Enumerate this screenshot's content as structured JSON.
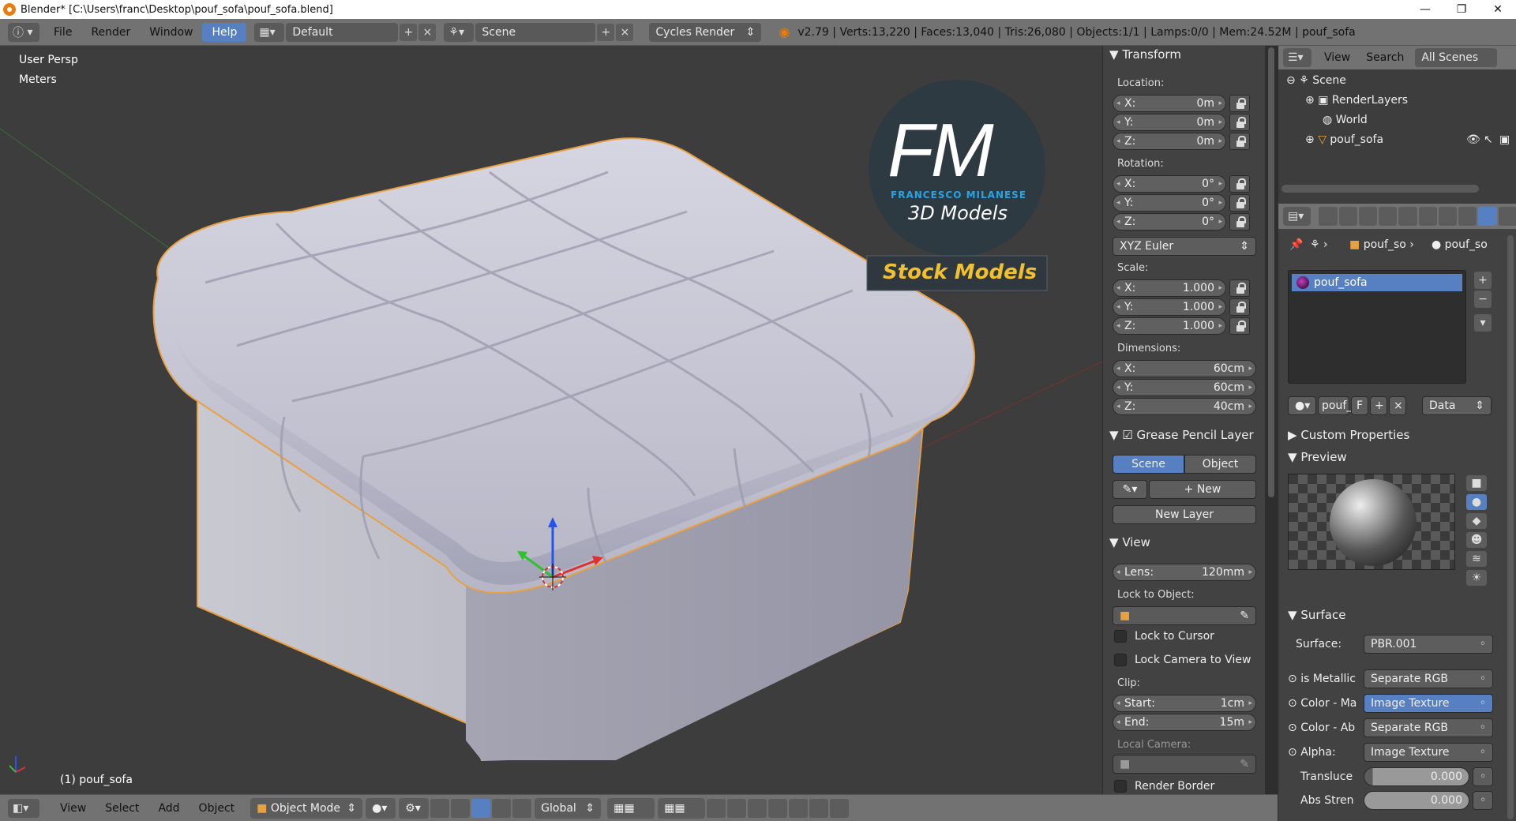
{
  "window": {
    "title": "Blender* [C:\\Users\\franc\\Desktop\\pouf_sofa\\pouf_sofa.blend]"
  },
  "topbar": {
    "menus": [
      "File",
      "Render",
      "Window",
      "Help"
    ],
    "screen": "Default",
    "scene": "Scene",
    "engine": "Cycles Render",
    "stats": "v2.79 | Verts:13,220 | Faces:13,040 | Tris:26,080 | Objects:1/1 | Lamps:0/0 | Mem:24.52M | pouf_sofa"
  },
  "viewport": {
    "view_name": "User Persp",
    "units": "Meters",
    "object_label": "(1) pouf_sofa",
    "logo": {
      "letters": "FM",
      "name": "FRANCESCO MILANESE",
      "sub": "3D Models",
      "badge": "Stock Models"
    }
  },
  "npanel": {
    "transform": {
      "header": "Transform",
      "location_label": "Location:",
      "location": [
        {
          "k": "X:",
          "v": "0m"
        },
        {
          "k": "Y:",
          "v": "0m"
        },
        {
          "k": "Z:",
          "v": "0m"
        }
      ],
      "rotation_label": "Rotation:",
      "rotation": [
        {
          "k": "X:",
          "v": "0°"
        },
        {
          "k": "Y:",
          "v": "0°"
        },
        {
          "k": "Z:",
          "v": "0°"
        }
      ],
      "rotation_mode": "XYZ Euler",
      "scale_label": "Scale:",
      "scale": [
        {
          "k": "X:",
          "v": "1.000"
        },
        {
          "k": "Y:",
          "v": "1.000"
        },
        {
          "k": "Z:",
          "v": "1.000"
        }
      ],
      "dimensions_label": "Dimensions:",
      "dimensions": [
        {
          "k": "X:",
          "v": "60cm"
        },
        {
          "k": "Y:",
          "v": "60cm"
        },
        {
          "k": "Z:",
          "v": "40cm"
        }
      ]
    },
    "grease": {
      "header": "Grease Pencil Layer",
      "tab_scene": "Scene",
      "tab_object": "Object",
      "new": "New",
      "new_layer": "New Layer"
    },
    "view": {
      "header": "View",
      "lens_k": "Lens:",
      "lens_v": "120mm",
      "lock_object": "Lock to Object:",
      "lock_cursor": "Lock to Cursor",
      "lock_camera": "Lock Camera to View",
      "clip": "Clip:",
      "start_k": "Start:",
      "start_v": "1cm",
      "end_k": "End:",
      "end_v": "15m",
      "local_camera": "Local Camera:",
      "render_border": "Render Border"
    }
  },
  "outliner": {
    "view": "View",
    "search": "Search",
    "filter": "All Scenes",
    "items": [
      "Scene",
      "RenderLayers",
      "World",
      "pouf_sofa"
    ]
  },
  "properties": {
    "crumb1": "pouf_so",
    "crumb2": "pouf_so",
    "material_slot": "pouf_sofa",
    "mat_name": "pouf_",
    "mat_f": "F",
    "mat_link": "Data",
    "custom_props": "Custom Properties",
    "preview": "Preview",
    "surface_header": "Surface",
    "surface_k": "Surface:",
    "surface_v": "PBR.001",
    "inputs": [
      {
        "k": "is Metallic",
        "v": "Separate RGB"
      },
      {
        "k": "Color - Ma",
        "v": "Image Texture"
      },
      {
        "k": "Color - Ab",
        "v": "Separate RGB"
      },
      {
        "k": "Alpha:",
        "v": "Image Texture"
      }
    ],
    "translucency_k": "Transluce",
    "translucency_v": "0.000",
    "abs_k": "Abs Stren",
    "abs_v": "0.000"
  },
  "bottombar": {
    "menus": [
      "View",
      "Select",
      "Add",
      "Object"
    ],
    "mode": "Object Mode",
    "orientation": "Global"
  }
}
